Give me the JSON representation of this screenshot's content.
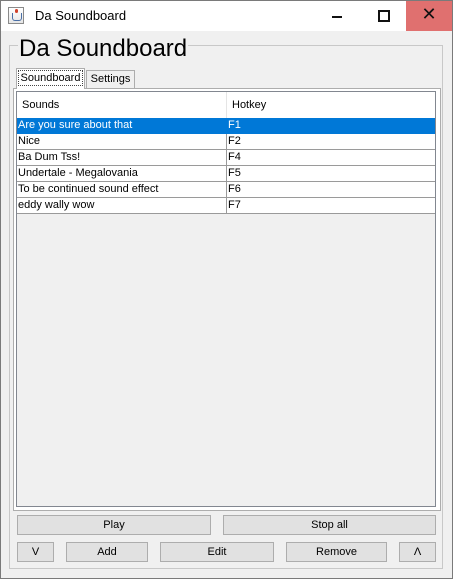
{
  "window": {
    "title": "Da Soundboard"
  },
  "app": {
    "heading": "Da Soundboard"
  },
  "titlebar": {
    "minimize_glyph": "—",
    "maximize_glyph": "☐",
    "close_glyph": "✕"
  },
  "tabs": [
    {
      "label": "Soundboard",
      "selected": true
    },
    {
      "label": "Settings",
      "selected": false
    }
  ],
  "table": {
    "columns": [
      "Sounds",
      "Hotkey"
    ],
    "rows": [
      {
        "name": "Are you sure about that",
        "key": "F1",
        "selected": true
      },
      {
        "name": "Nice",
        "key": "F2",
        "selected": false
      },
      {
        "name": "Ba Dum Tss!",
        "key": "F4",
        "selected": false
      },
      {
        "name": "Undertale - Megalovania",
        "key": "F5",
        "selected": false
      },
      {
        "name": "To be continued sound effect",
        "key": "F6",
        "selected": false
      },
      {
        "name": "eddy wally wow",
        "key": "F7",
        "selected": false
      }
    ]
  },
  "buttons": {
    "play": "Play",
    "stop_all": "Stop all",
    "move_down": "V",
    "add": "Add",
    "edit": "Edit",
    "remove": "Remove",
    "move_up": "Λ"
  },
  "colors": {
    "selection": "#0078d7",
    "close_button": "#e0706f"
  },
  "icons": {
    "app": "java-cup-icon"
  }
}
